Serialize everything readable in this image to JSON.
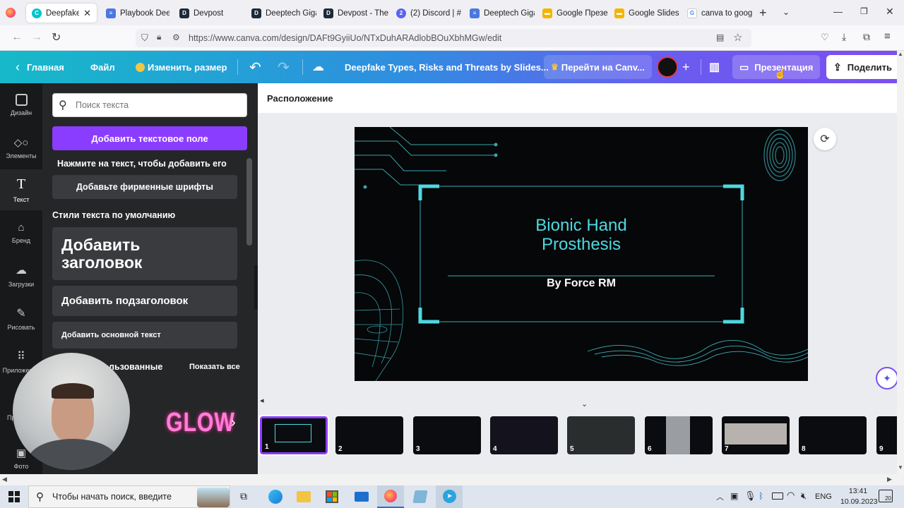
{
  "browser": {
    "tabs": [
      {
        "title": "Deepfake Ty",
        "color": "#00c4cc",
        "glyph": "C",
        "active": true
      },
      {
        "title": "Playbook Deep",
        "color": "#4a78e0",
        "glyph": "≡"
      },
      {
        "title": "Devpost",
        "color": "#1c2b3a",
        "glyph": "D"
      },
      {
        "title": "Deeptech Giga",
        "color": "#1c2b3a",
        "glyph": "D"
      },
      {
        "title": "Devpost - The",
        "color": "#1c2b3a",
        "glyph": "D"
      },
      {
        "title": "(2) Discord | #",
        "color": "#5865f2",
        "glyph": "2"
      },
      {
        "title": "Deeptech Giga",
        "color": "#4a78e0",
        "glyph": "≡"
      },
      {
        "title": "Google Презе",
        "color": "#f5b400",
        "glyph": "▬"
      },
      {
        "title": "Google Slides",
        "color": "#f5b400",
        "glyph": "▬"
      },
      {
        "title": "canva to googl",
        "color": "#4285f4",
        "glyph": "G"
      }
    ],
    "url": "https://www.canva.com/design/DAFt9GyiiUo/NTxDuhARAdlobBOuXbhMGw/edit"
  },
  "header": {
    "home": "Главная",
    "file": "Файл",
    "resize": "Изменить размер",
    "doc_title": "Deepfake Types, Risks and Threats by Slides...",
    "upgrade": "Перейти на Canv...",
    "present": "Презентация",
    "share": "Поделить"
  },
  "rail": [
    {
      "label": "Дизайн",
      "icon": "layout-icon"
    },
    {
      "label": "Элементы",
      "icon": "shapes-icon"
    },
    {
      "label": "Текст",
      "icon": "text-icon",
      "active": true
    },
    {
      "label": "Бренд",
      "icon": "brand-icon"
    },
    {
      "label": "Загрузки",
      "icon": "upload-icon"
    },
    {
      "label": "Рисовать",
      "icon": "draw-icon"
    },
    {
      "label": "Приложения",
      "icon": "apps-icon"
    },
    {
      "label": "Пр",
      "icon": "projects-icon"
    },
    {
      "label": "Фото",
      "icon": "photo-icon"
    }
  ],
  "panel": {
    "search_placeholder": "Поиск текста",
    "add_textbox": "Добавить текстовое поле",
    "hint": "Нажмите на текст, чтобы добавить его",
    "brand_fonts": "Добавьте фирменные шрифты",
    "default_styles": "Стили текста по умолчанию",
    "heading": "Добавить заголовок",
    "subheading": "Добавить подзаголовок",
    "body": "Добавить основной текст",
    "recent": "льзованные",
    "show_all": "Показать все",
    "glow": "GLOW"
  },
  "canvas": {
    "position_label": "Расположение",
    "slide_title_line1": "Bionic Hand",
    "slide_title_line2": "Prosthesis",
    "slide_author": "By Force RM",
    "accent": "#4fd8e0"
  },
  "thumbnails": [
    "1",
    "2",
    "3",
    "4",
    "5",
    "6",
    "7",
    "8",
    "9"
  ],
  "taskbar": {
    "search_placeholder": "Чтобы начать поиск, введите",
    "lang": "ENG",
    "time": "13:41",
    "date": "10.09.2023",
    "notifications": "20"
  }
}
